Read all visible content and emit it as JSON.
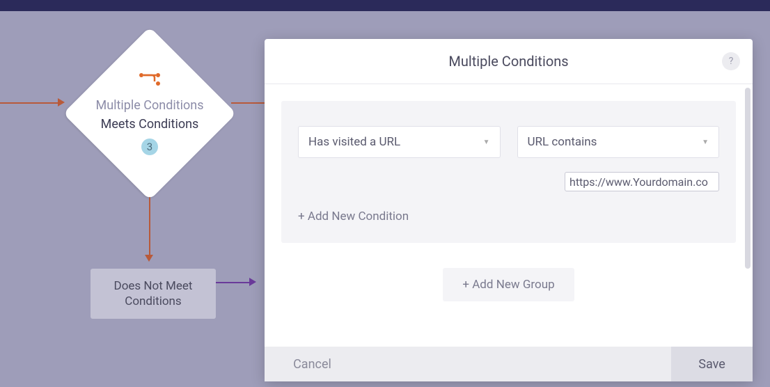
{
  "canvas": {
    "diamond": {
      "title": "Multiple Conditions",
      "subtitle": "Meets Conditions",
      "badge": "3"
    },
    "rect": {
      "label": "Does Not Meet Conditions"
    }
  },
  "modal": {
    "title": "Multiple Conditions",
    "help": "?",
    "condition": {
      "field_select": "Has visited a URL",
      "operator_select": "URL contains",
      "url_value": "https://www.Yourdomain.co"
    },
    "add_condition": "+ Add New Condition",
    "add_group": "+ Add New Group",
    "cancel": "Cancel",
    "save": "Save"
  }
}
